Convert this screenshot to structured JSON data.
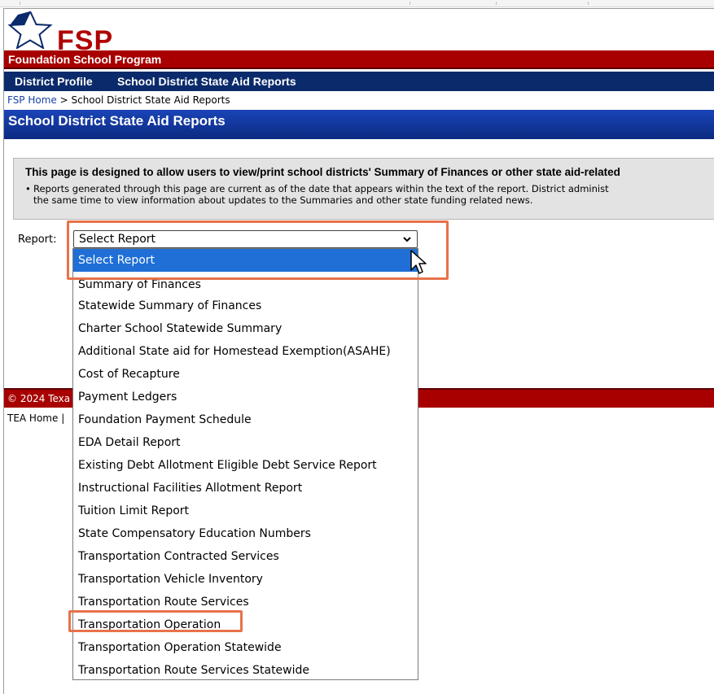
{
  "site": {
    "logo_text": "FSP",
    "program_name": "Foundation School Program"
  },
  "nav": {
    "items": [
      "District Profile",
      "School District State Aid Reports"
    ]
  },
  "breadcrumb": {
    "home": "FSP Home",
    "separator": " > ",
    "current": "School District State Aid Reports"
  },
  "page_title": "School District State Aid Reports",
  "info": {
    "title": "This page is designed to allow users to view/print school districts' Summary of Finances or other state aid-related",
    "bullet": "•",
    "text_line1": "Reports generated through this page are current as of the date that appears within the text of the report. District administ",
    "text_line2": "the same time to view information about updates to the Summaries and other state funding related news."
  },
  "report": {
    "label": "Report:",
    "selected_value": "Select Report",
    "options": [
      "Select Report",
      "Summary of Finances",
      "Statewide Summary of Finances",
      "Charter School Statewide Summary",
      "Additional State aid for Homestead Exemption(ASAHE)",
      "Cost of Recapture",
      "Payment Ledgers",
      "Foundation Payment Schedule",
      "EDA Detail Report",
      "Existing Debt Allotment Eligible Debt Service Report",
      "Instructional Facilities Allotment Report",
      "Tuition Limit Report",
      "State Compensatory Education Numbers",
      "Transportation Contracted Services",
      "Transportation Vehicle Inventory",
      "Transportation Route Services",
      "Transportation Operation",
      "Transportation Operation Statewide",
      "Transportation Route Services Statewide"
    ]
  },
  "footer": {
    "copyright": "© 2024 Texa",
    "links": "TEA Home |"
  },
  "colors": {
    "brand_red": "#a80000",
    "nav_blue": "#0b2a6b",
    "title_blue": "#1a44b8",
    "selected_option": "#1f6fd6",
    "highlight": "#e8724a"
  }
}
